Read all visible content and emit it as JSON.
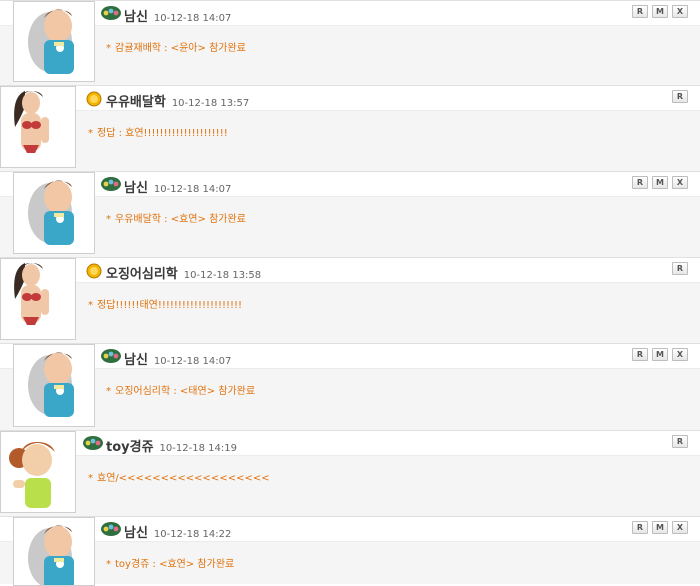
{
  "posts": [
    {
      "nick": "남신",
      "time": "10-12-18 14:07",
      "message": "감귤재배학 : <윤아> 참가완료",
      "avatar": "boy",
      "badge": "cart",
      "buttons": [
        "R",
        "M",
        "X"
      ]
    },
    {
      "nick": "우유배달학",
      "time": "10-12-18 13:57",
      "message": "정답 : 효연!!!!!!!!!!!!!!!!!!!!!",
      "avatar": "girl-bikini",
      "badge": "medal",
      "buttons": [
        "R"
      ]
    },
    {
      "nick": "남신",
      "time": "10-12-18 14:07",
      "message": "우유배달학 : <효연> 참가완료",
      "avatar": "boy",
      "badge": "cart",
      "buttons": [
        "R",
        "M",
        "X"
      ]
    },
    {
      "nick": "오징어심리학",
      "time": "10-12-18 13:58",
      "message": "정답!!!!!!태연!!!!!!!!!!!!!!!!!!!!!",
      "avatar": "girl-bikini",
      "badge": "medal",
      "buttons": [
        "R"
      ]
    },
    {
      "nick": "남신",
      "time": "10-12-18 14:07",
      "message": "오징어심리학 : <태연> 참가완료",
      "avatar": "boy",
      "badge": "cart",
      "buttons": [
        "R",
        "M",
        "X"
      ]
    },
    {
      "nick": "toy경쥬",
      "time": "10-12-18 14:19",
      "message": "효연/<<<<<<<<<<<<<<<<<<",
      "avatar": "girl-pigtail",
      "badge": "cart",
      "buttons": [
        "R"
      ]
    },
    {
      "nick": "남신",
      "time": "10-12-18 14:22",
      "message": "toy경쥬 : <효연> 참가완료",
      "avatar": "boy",
      "badge": "cart",
      "buttons": [
        "R",
        "M",
        "X"
      ]
    }
  ],
  "colors": {
    "message": "#e0730f",
    "nick": "#3a3a3a"
  },
  "message_bullet": "*"
}
